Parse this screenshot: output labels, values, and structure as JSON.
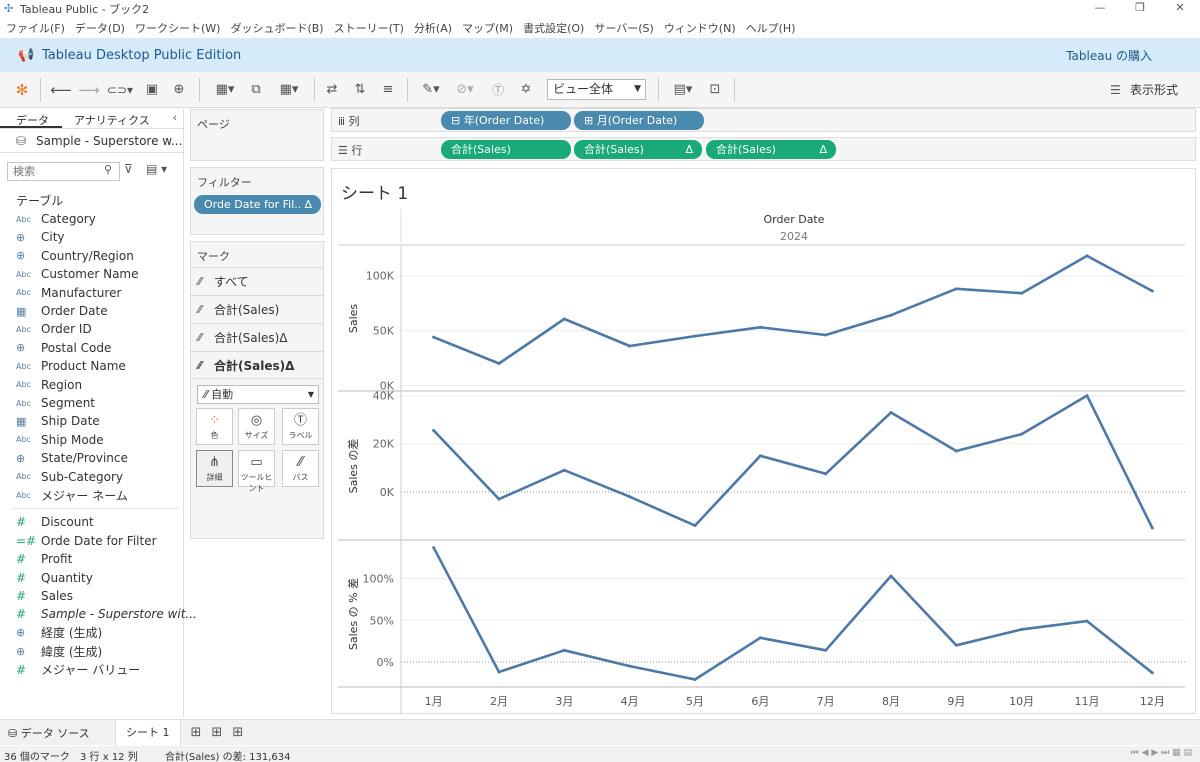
{
  "window": {
    "title": "Tableau Public - ブック2",
    "controls": [
      "—",
      "❐",
      "✕"
    ]
  },
  "menu": [
    "ファイル(F)",
    "データ(D)",
    "ワークシート(W)",
    "ダッシュボード(B)",
    "ストーリー(T)",
    "分析(A)",
    "マップ(M)",
    "書式設定(O)",
    "サーバー(S)",
    "ウィンドウ(N)",
    "ヘルプ(H)"
  ],
  "banner": {
    "edition": "Tableau Desktop Public Edition",
    "buy": "Tableau の購入"
  },
  "toolbar": {
    "view_select": "ビュー全体",
    "show_me": "表示形式"
  },
  "data_pane": {
    "tab_data": "データ",
    "tab_analytics": "アナリティクス",
    "datasource": "Sample - Superstore w...",
    "search_placeholder": "検索",
    "tables_heading": "テーブル",
    "dimensions": [
      {
        "type": "Abc",
        "name": "Category"
      },
      {
        "type": "globe",
        "name": "City"
      },
      {
        "type": "globe",
        "name": "Country/Region"
      },
      {
        "type": "Abc",
        "name": "Customer Name"
      },
      {
        "type": "Abc",
        "name": "Manufacturer"
      },
      {
        "type": "cal",
        "name": "Order Date"
      },
      {
        "type": "Abc",
        "name": "Order ID"
      },
      {
        "type": "globe",
        "name": "Postal Code"
      },
      {
        "type": "Abc",
        "name": "Product Name"
      },
      {
        "type": "Abc",
        "name": "Region"
      },
      {
        "type": "Abc",
        "name": "Segment"
      },
      {
        "type": "cal",
        "name": "Ship Date"
      },
      {
        "type": "Abc",
        "name": "Ship Mode"
      },
      {
        "type": "globe",
        "name": "State/Province"
      },
      {
        "type": "Abc",
        "name": "Sub-Category"
      },
      {
        "type": "Abc",
        "name": "メジャー ネーム"
      }
    ],
    "measures": [
      {
        "type": "#",
        "name": "Discount"
      },
      {
        "type": "=#",
        "name": "Orde Date for Filter"
      },
      {
        "type": "#",
        "name": "Profit"
      },
      {
        "type": "#",
        "name": "Quantity"
      },
      {
        "type": "#",
        "name": "Sales"
      },
      {
        "type": "#",
        "name": "Sample - Superstore wit..."
      },
      {
        "type": "globe",
        "name": "経度 (生成)"
      },
      {
        "type": "globe",
        "name": "緯度 (生成)"
      },
      {
        "type": "#",
        "name": "メジャー バリュー"
      }
    ]
  },
  "pages": {
    "title": "ページ"
  },
  "filters": {
    "title": "フィルター",
    "pill": "Orde Date for Fil..",
    "pill_delta": "Δ"
  },
  "marks": {
    "title": "マーク",
    "rows": [
      "すべて",
      "合計(Sales)",
      "合計(Sales)Δ",
      "合計(Sales)Δ"
    ],
    "mark_type": "自動",
    "buttons": [
      "色",
      "サイズ",
      "ラベル",
      "詳細",
      "ツールヒント",
      "パス"
    ]
  },
  "shelves": {
    "columns_label": "列",
    "rows_label": "行",
    "columns": [
      "⊟ 年(Order Date)",
      "⊞ 月(Order Date)"
    ],
    "rows": [
      "合計(Sales)",
      "合計(Sales)",
      "合計(Sales)"
    ],
    "delta": "Δ"
  },
  "view": {
    "sheet_title": "シート 1",
    "header": "Order Date",
    "year": "2024"
  },
  "sheetbar": {
    "datasource": "データ ソース",
    "sheet": "シート 1"
  },
  "status": {
    "marks": "36 個のマーク",
    "dims": "3 行 x 12 列",
    "sum": "合計(Sales) の差: 131,634"
  },
  "colors": {
    "line": "#4e79a7",
    "pill_blue": "#4a8aae",
    "pill_green": "#1aaa7a",
    "banner": "#d6ebfa"
  },
  "chart_data": {
    "type": "line",
    "categories": [
      "1月",
      "2月",
      "3月",
      "4月",
      "5月",
      "6月",
      "7月",
      "8月",
      "9月",
      "10月",
      "11月",
      "12月"
    ],
    "panels": [
      {
        "ylabel": "Sales",
        "ticks": [
          0,
          50000,
          100000
        ],
        "tick_labels": [
          "0K",
          "50K",
          "100K"
        ],
        "ylim": [
          -5000,
          127000
        ],
        "values": [
          44000,
          20000,
          60500,
          36000,
          45000,
          53000,
          46000,
          64000,
          88000,
          84000,
          118000,
          86000
        ]
      },
      {
        "ylabel": "Sales の差",
        "ticks": [
          0,
          20000,
          40000
        ],
        "tick_labels": [
          "0K",
          "20K",
          "40K"
        ],
        "ylim": [
          -20000,
          41500
        ],
        "values": [
          25500,
          -3000,
          9000,
          -2000,
          -14000,
          15000,
          7500,
          33000,
          17000,
          24000,
          40000,
          -15000
        ],
        "zero_line": true
      },
      {
        "ylabel": "Sales の % 差",
        "ticks": [
          0,
          0.5,
          1.0
        ],
        "tick_labels": [
          "0%",
          "50%",
          "100%"
        ],
        "ylim": [
          -0.3,
          1.45
        ],
        "values": [
          1.37,
          -0.12,
          0.14,
          -0.05,
          -0.21,
          0.29,
          0.14,
          1.03,
          0.2,
          0.39,
          0.49,
          -0.13
        ],
        "zero_line": true
      }
    ],
    "grid": true
  }
}
